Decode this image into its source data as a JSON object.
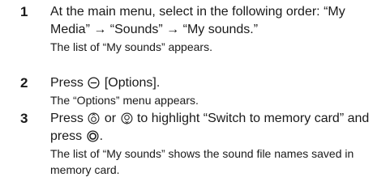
{
  "steps": [
    {
      "number": "1",
      "instruction": "At the main menu, select in the following order: “My Media” → “Sounds” → “My sounds.”",
      "result": "The list of “My sounds” appears."
    },
    {
      "number": "2",
      "instruction_pre": "Press",
      "instruction_post": "[Options].",
      "result": "The “Options” menu appears."
    },
    {
      "number": "3",
      "instruction_pre": "Press",
      "instruction_or": "or",
      "instruction_mid": "to highlight “Switch to memory card” and press",
      "instruction_end": ".",
      "result": "The list of “My sounds” shows the sound file names saved in memory card."
    }
  ],
  "icons": {
    "options_key": "minus-circle-icon",
    "up_key": "up-key-icon",
    "down_key": "down-key-icon",
    "center_key": "center-key-icon"
  }
}
